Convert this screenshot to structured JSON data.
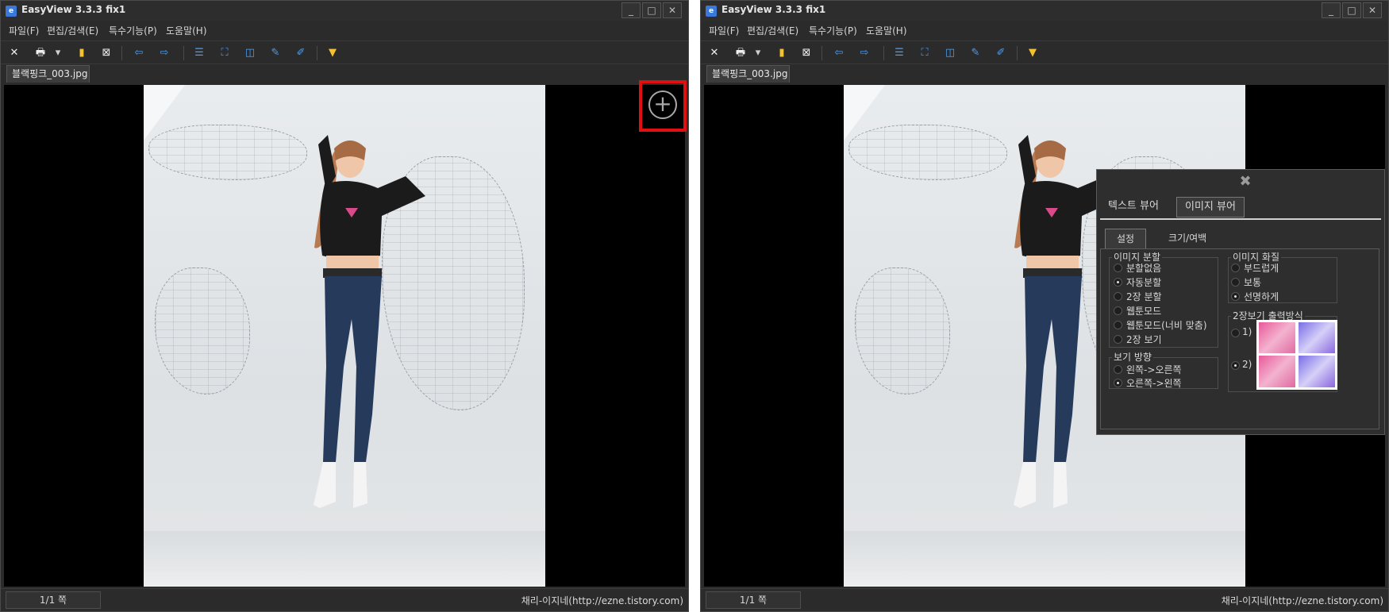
{
  "app": {
    "title": "EasyView  3.3.3 fix1",
    "icon_name": "easyview-app-icon",
    "min_label": "_",
    "max_label": "□",
    "close_label": "✕"
  },
  "menu": {
    "items": [
      "파일(F)",
      "편집/검색(E)",
      "특수기능(P)",
      "도움말(H)"
    ]
  },
  "toolbar": {
    "icons": [
      "close-file-icon",
      "print-icon",
      "dropdown-arrow-icon",
      "bookmark-icon",
      "delete-icon",
      "prev-arrow-icon",
      "next-arrow-icon",
      "list-icon",
      "fit-screen-icon",
      "two-page-icon",
      "pin-icon",
      "pin-edit-icon",
      "brush-icon"
    ],
    "glyphs": {
      "close": "✕",
      "print": "🖶",
      "dropdown": "▾",
      "bookmark": "▮",
      "delete": "⊠",
      "prev": "⇦",
      "next": "⇨",
      "list": "☰",
      "fit": "⛶",
      "two_page": "◫",
      "pin": "✎",
      "pin_edit": "✐",
      "brush": "▼"
    }
  },
  "document": {
    "tab_label": "블랙핑크_003.jpg",
    "zoom_glyph": "+"
  },
  "status": {
    "page": "1/1 쪽",
    "credit": "채리-이지네(http://ezne.tistory.com)"
  },
  "settings_panel": {
    "close_glyph": "✖",
    "tabs": [
      "텍스트 뷰어",
      "이미지 뷰어"
    ],
    "active_tab": "이미지 뷰어",
    "subtabs": [
      "설정",
      "크기/여백"
    ],
    "active_subtab": "설정",
    "split_group": {
      "label": "이미지 분할",
      "options": [
        "분할없음",
        "자동분할",
        "2장 분할",
        "웹툰모드",
        "웹툰모드(너비 맞춤)",
        "2장 보기"
      ],
      "selected": "자동분할"
    },
    "direction_group": {
      "label": "보기 방향",
      "options": [
        "왼쪽->오른쪽",
        "오른쪽->왼쪽"
      ],
      "selected": "오른쪽->왼쪽"
    },
    "quality_group": {
      "label": "이미지 화질",
      "options": [
        "부드럽게",
        "보통",
        "선명하게"
      ],
      "selected": "선명하게"
    },
    "two_page_group": {
      "label": "2장보기 출력방식",
      "options": [
        "1)",
        "2)"
      ],
      "selected": "2)"
    }
  },
  "colors": {
    "window_bg": "#2b2b2b",
    "highlight": "#e01010",
    "accent_blue": "#4a9ff5",
    "accent_yellow": "#f2c230"
  }
}
